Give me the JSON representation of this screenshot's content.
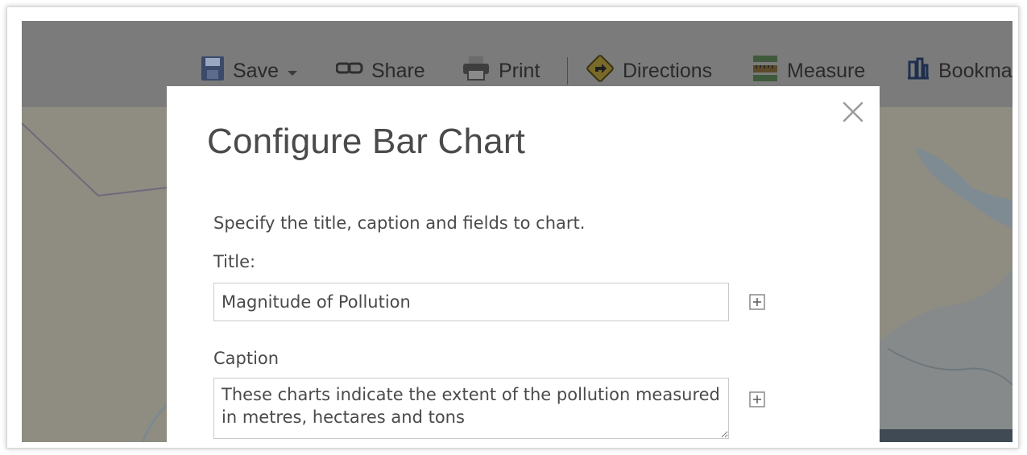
{
  "toolbar": {
    "items": [
      {
        "label": "Save",
        "icon": "floppy-disk-icon",
        "has_dropdown": true
      },
      {
        "label": "Share",
        "icon": "link-icon"
      },
      {
        "label": "Print",
        "icon": "printer-icon"
      },
      {
        "label": "Directions",
        "icon": "directions-sign-icon"
      },
      {
        "label": "Measure",
        "icon": "ruler-icon"
      },
      {
        "label": "Bookma",
        "icon": "bookmark-icon"
      }
    ]
  },
  "dialog": {
    "title": "Configure Bar Chart",
    "instructions": "Specify the title, caption and fields to chart.",
    "title_field": {
      "label": "Title:",
      "value": "Magnitude of Pollution"
    },
    "caption_field": {
      "label": "Caption",
      "value": "These charts indicate the extent of the pollution measured in metres, hectares and tons"
    }
  },
  "colors": {
    "overlay_dim": "#8c8a84",
    "dialog_bg": "#ffffff",
    "text": "#4a4a4a",
    "field_border": "#c9c9c9"
  }
}
